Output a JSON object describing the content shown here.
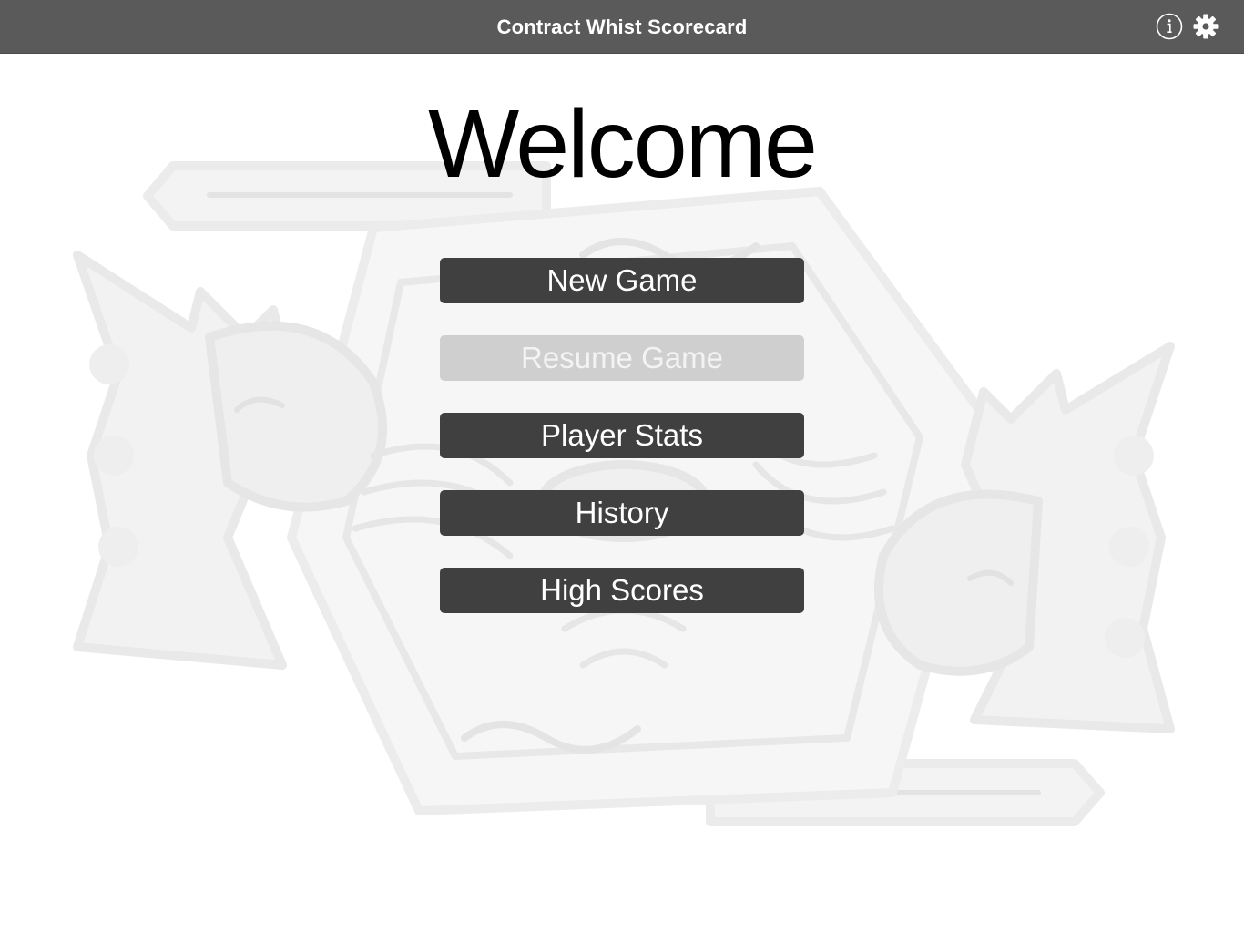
{
  "navbar": {
    "title": "Contract Whist Scorecard",
    "info_icon": "info-circle-icon",
    "settings_icon": "gear-icon",
    "background_color": "#5a5a5a"
  },
  "main": {
    "heading": "Welcome",
    "background_art": "king-playing-card-watermark"
  },
  "menu": {
    "items": [
      {
        "label": "New Game",
        "enabled": true
      },
      {
        "label": "Resume Game",
        "enabled": false
      },
      {
        "label": "Player Stats",
        "enabled": true
      },
      {
        "label": "History",
        "enabled": true
      },
      {
        "label": "High Scores",
        "enabled": true
      }
    ],
    "button_color": "#404040",
    "disabled_color": "#cfcfcf"
  }
}
